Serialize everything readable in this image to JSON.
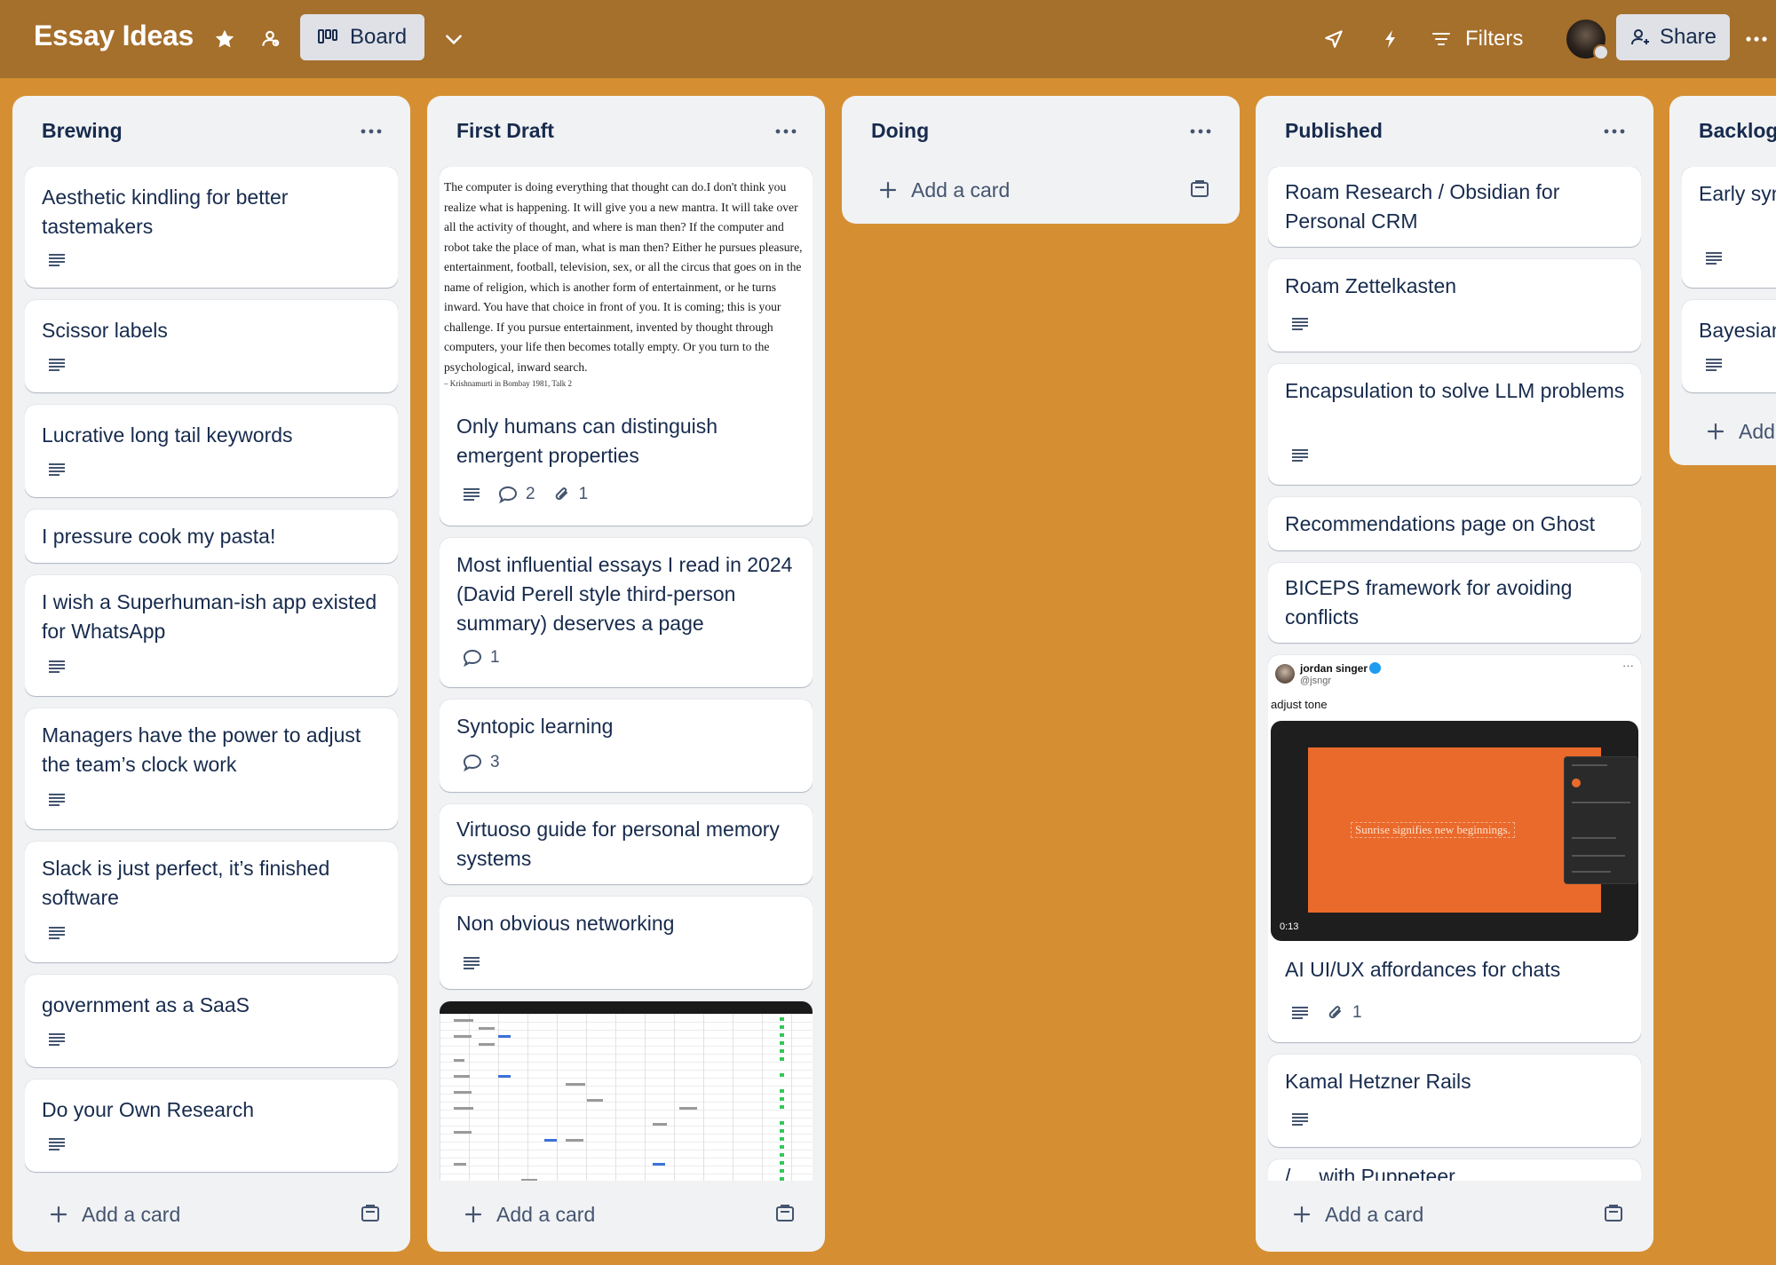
{
  "header": {
    "board_title": "Essay Ideas",
    "view_label": "Board",
    "filters_label": "Filters",
    "share_label": "Share",
    "icons": [
      "star-icon",
      "workspace-visible-icon",
      "board-icon",
      "chevron-down-icon",
      "power-ups-icon",
      "automation-icon",
      "filter-icon",
      "share-user-icon",
      "more-icon"
    ]
  },
  "colors": {
    "board_background": "#D58F32",
    "header_background": "#A56F2C",
    "list_background": "#F1F2F4",
    "card_background": "#FFFFFF",
    "text": "#172B4D"
  },
  "add_card_label": "Add a card",
  "lists": [
    {
      "title": "Brewing",
      "cards": [
        {
          "title": "Aesthetic kindling for better tastemakers"
        },
        {
          "title": "Scissor labels"
        },
        {
          "title": "Lucrative long tail keywords"
        },
        {
          "title": "I pressure cook my pasta!"
        },
        {
          "title": "I wish a Superhuman-ish app existed for WhatsApp"
        },
        {
          "title": "Managers have the power to adjust the team’s clock work"
        },
        {
          "title": "Slack is just perfect, it’s finished software"
        },
        {
          "title": "government as a SaaS"
        },
        {
          "title": "Do your Own Research"
        }
      ]
    },
    {
      "title": "First Draft",
      "cards": [
        {
          "title": "Only humans can distinguish emergent properties",
          "cover_quote": "The computer is doing everything that thought can do.I don't think you realize what is happening. It will give you a new mantra. It will take over all the activity of thought, and where is man then? If the computer and robot take the place of man, what is man then? Either he pursues pleasure, entertainment, football, television, sex, or all the circus that goes on in the name of religion, which is another form of entertainment, or he turns inward. You have that choice in front of you. It is coming; this is your challenge. If you pursue entertainment, invented by thought through computers, your life then becomes totally empty. Or you turn to the psychological, inward search.",
          "cover_cite": "– Krishnamurti in Bombay 1981, Talk 2",
          "comments": "2",
          "attachments": "1"
        },
        {
          "title": "Most influential essays I read in 2024 (David Perell style third-person summary) deserves a page",
          "comments": "1"
        },
        {
          "title": "Syntopic learning",
          "comments": "3"
        },
        {
          "title": "Virtuoso guide for personal memory systems"
        },
        {
          "title": "Non obvious networking"
        }
      ]
    },
    {
      "title": "Doing",
      "cards": []
    },
    {
      "title": "Published",
      "cards": [
        {
          "title": "Roam Research / Obsidian for Personal CRM"
        },
        {
          "title": "Roam Zettelkasten"
        },
        {
          "title": "Encapsulation to solve LLM problems"
        },
        {
          "title": "Recommendations page on Ghost"
        },
        {
          "title": "BICEPS framework for avoiding conflicts"
        },
        {
          "title": "AI UI/UX affordances for chats",
          "attachments": "1",
          "tweet": {
            "name": "jordan singer",
            "handle": "@jsngr",
            "text": "adjust tone",
            "video_sentence": "Sunrise signifies new beginnings.",
            "video_time": "0:13"
          }
        },
        {
          "title": "Kamal Hetzner Rails"
        },
        {
          "title": "/ ... with Puppeteer"
        }
      ]
    },
    {
      "title": "Backlog",
      "cards": [
        {
          "title": "Early syn dangero"
        },
        {
          "title": "Bayesian"
        }
      ]
    }
  ]
}
